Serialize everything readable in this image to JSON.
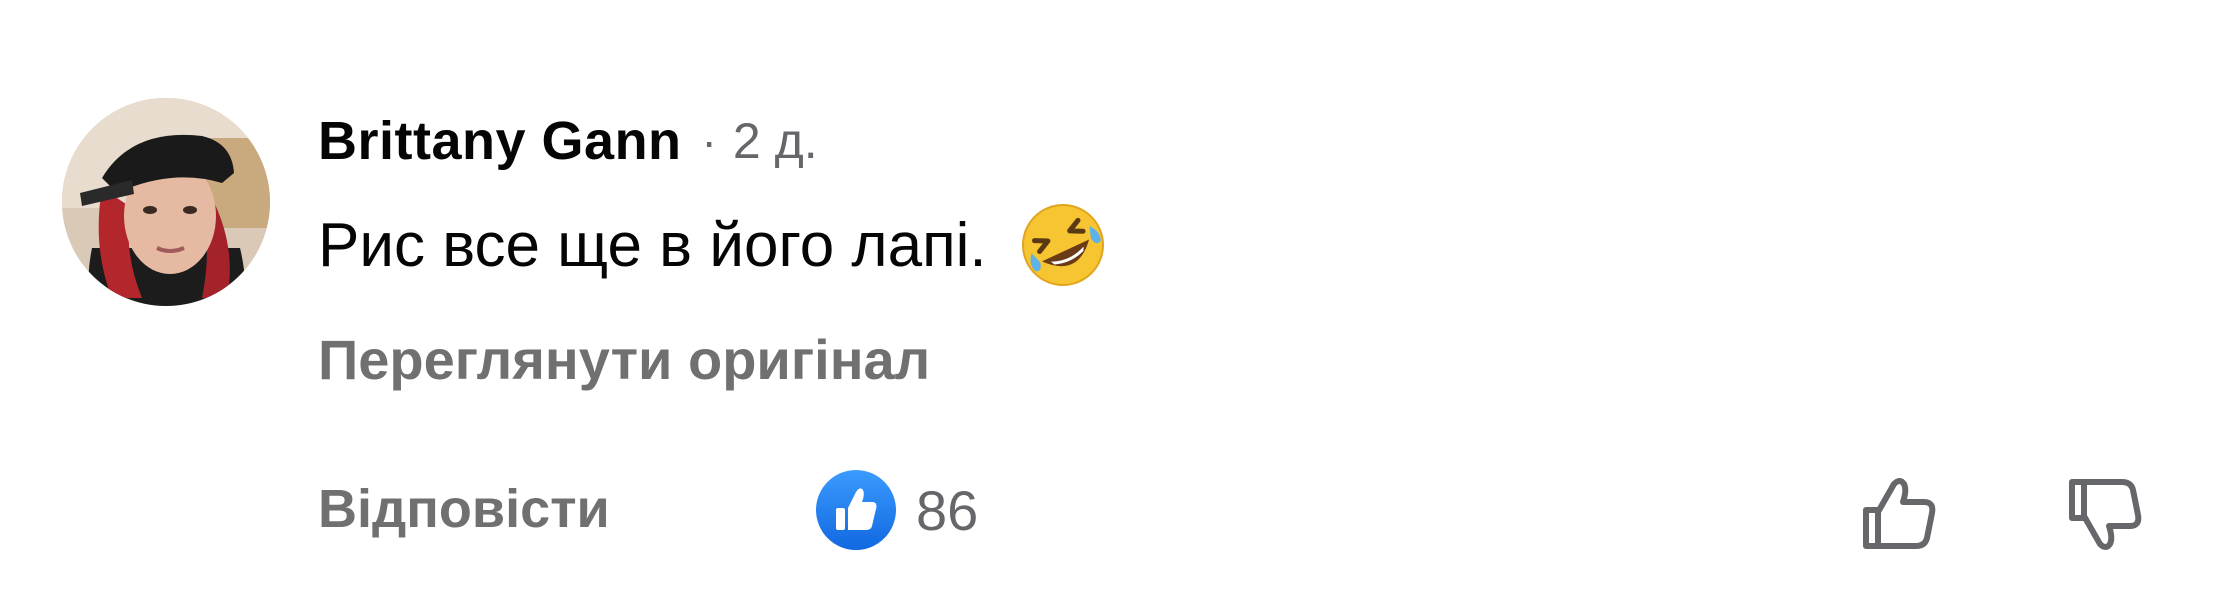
{
  "comment": {
    "author": "Brittany Gann",
    "separator": "·",
    "time": "2 д.",
    "text": "Рис все ще в його лапі.",
    "emoji": "rolling-on-floor-laughing-emoji",
    "see_original_label": "Переглянути оригінал"
  },
  "actions": {
    "reply_label": "Відповісти",
    "reaction_icon": "like-icon",
    "reaction_count": "86",
    "upvote_icon": "thumbs-up-outline-icon",
    "downvote_icon": "thumbs-down-outline-icon"
  },
  "colors": {
    "text_primary": "#050505",
    "text_secondary": "#65676b",
    "like_blue": "#1877f2"
  }
}
